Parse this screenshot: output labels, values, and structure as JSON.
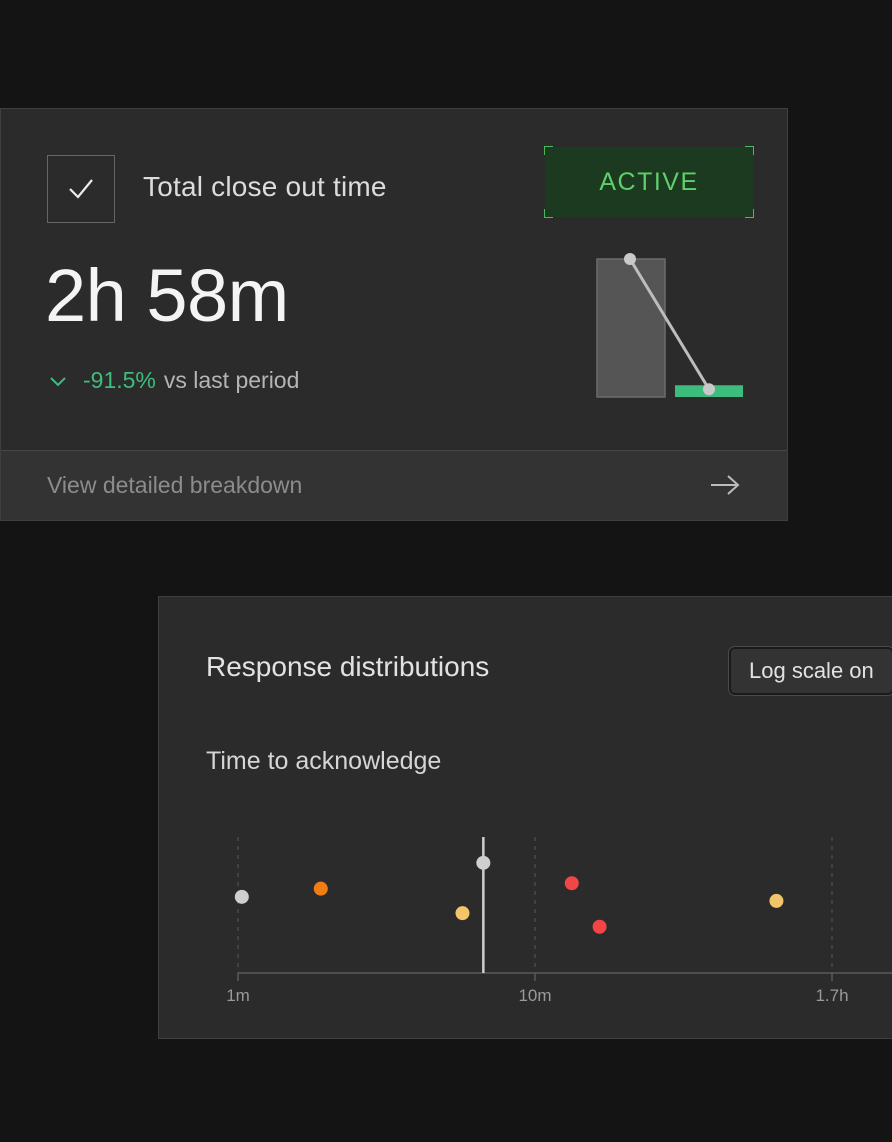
{
  "metric_card": {
    "title": "Total close out time",
    "status": "ACTIVE",
    "value": "2h 58m",
    "change": "-91.5%",
    "change_label": "vs last period",
    "footer_link": "View detailed breakdown",
    "mini_chart": {
      "previous": 100,
      "current": 8.5
    },
    "colors": {
      "positive": "#3dbd7d",
      "badge_text": "#5fcf6b",
      "badge_bg": "#1c3a1f"
    }
  },
  "distribution_card": {
    "title": "Response distributions",
    "toggle_label": "Log scale on",
    "subtitle": "Time to acknowledge"
  },
  "chart_data": {
    "type": "scatter",
    "title": "Time to acknowledge",
    "xscale": "log",
    "xlim_minutes": [
      1,
      102
    ],
    "tick_labels": [
      "1m",
      "10m",
      "1.7h"
    ],
    "tick_values_minutes": [
      1,
      10,
      100
    ],
    "marker_minutes": 6.7,
    "points": [
      {
        "x": 1.03,
        "y": 0.56,
        "color": "#cfcfcf"
      },
      {
        "x": 1.9,
        "y": 0.62,
        "color": "#f07d12"
      },
      {
        "x": 5.7,
        "y": 0.44,
        "color": "#f2c56a"
      },
      {
        "x": 6.7,
        "y": 0.81,
        "color": "#cfcfcf"
      },
      {
        "x": 13.3,
        "y": 0.66,
        "color": "#f24545"
      },
      {
        "x": 16.5,
        "y": 0.34,
        "color": "#f24545"
      },
      {
        "x": 65,
        "y": 0.53,
        "color": "#f2c56a"
      }
    ],
    "grid": true
  }
}
